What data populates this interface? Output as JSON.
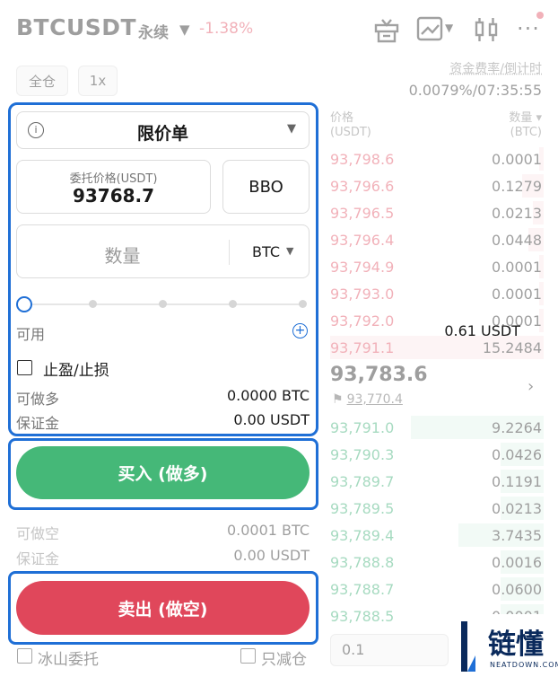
{
  "header": {
    "symbol": "BTCUSDT",
    "contract_type": "永续",
    "change_pct": "-1.38%",
    "icons": [
      "gift-icon",
      "chart-icon",
      "candlestick-icon",
      "more-icon"
    ]
  },
  "controls": {
    "margin_mode": "全仓",
    "leverage": "1x"
  },
  "funding": {
    "label": "资金费率/倒计时",
    "value": "0.0079%/07:35:55"
  },
  "orderbook": {
    "price_header": "价格",
    "price_unit": "(USDT)",
    "qty_header": "数量 ▾",
    "qty_unit": "(BTC)",
    "asks": [
      {
        "price": "93,798.6",
        "qty": "0.0001",
        "depth": 0.02
      },
      {
        "price": "93,796.6",
        "qty": "0.1279",
        "depth": 0.1
      },
      {
        "price": "93,796.5",
        "qty": "0.0213",
        "depth": 0.05
      },
      {
        "price": "93,796.4",
        "qty": "0.0448",
        "depth": 0.07
      },
      {
        "price": "93,794.9",
        "qty": "0.0001",
        "depth": 0.02
      },
      {
        "price": "93,793.0",
        "qty": "0.0001",
        "depth": 0.02
      },
      {
        "price": "93,792.0",
        "qty": "0.0001",
        "depth": 0.02
      },
      {
        "price": "93,791.1",
        "qty": "15.2484",
        "depth": 1.0
      }
    ],
    "last_price": "93,783.6",
    "mark_price": "93,770.4",
    "bids": [
      {
        "price": "93,791.0",
        "qty": "9.2264",
        "depth": 0.62
      },
      {
        "price": "93,790.3",
        "qty": "0.0426",
        "depth": 0.2
      },
      {
        "price": "93,789.7",
        "qty": "0.1191",
        "depth": 0.2
      },
      {
        "price": "93,789.5",
        "qty": "0.0213",
        "depth": 0.2
      },
      {
        "price": "93,789.4",
        "qty": "3.7435",
        "depth": 0.4
      },
      {
        "price": "93,788.8",
        "qty": "0.0016",
        "depth": 0.2
      },
      {
        "price": "93,788.7",
        "qty": "0.0600",
        "depth": 0.2
      },
      {
        "price": "93,788.5",
        "qty": "0.0001",
        "depth": 0.2
      }
    ],
    "depth_step": "0.1"
  },
  "order_form": {
    "order_type": "限价单",
    "price_label": "委托价格(USDT)",
    "price_value": "93768.7",
    "bbo_label": "BBO",
    "qty_placeholder": "数量",
    "qty_unit": "BTC",
    "available_label": "可用",
    "available_value": "0.61 USDT",
    "tpsl_label": "止盈/止损",
    "max_long_label": "可做多",
    "max_long_value": "0.0000 BTC",
    "margin_label": "保证金",
    "margin_long_value": "0.00 USDT",
    "buy_button": "买入 (做多)",
    "max_short_label": "可做空",
    "max_short_value": "0.0001 BTC",
    "margin_short_value": "0.00 USDT",
    "sell_button": "卖出 (做空)",
    "iceberg_label": "冰山委托",
    "reduce_only_label": "只减仓"
  },
  "watermark": {
    "text": "链懂",
    "sub": "NEATDOWN.COM"
  },
  "colors": {
    "accent": "#1f6fd6",
    "buy": "#45b878",
    "sell": "#e0475b"
  }
}
